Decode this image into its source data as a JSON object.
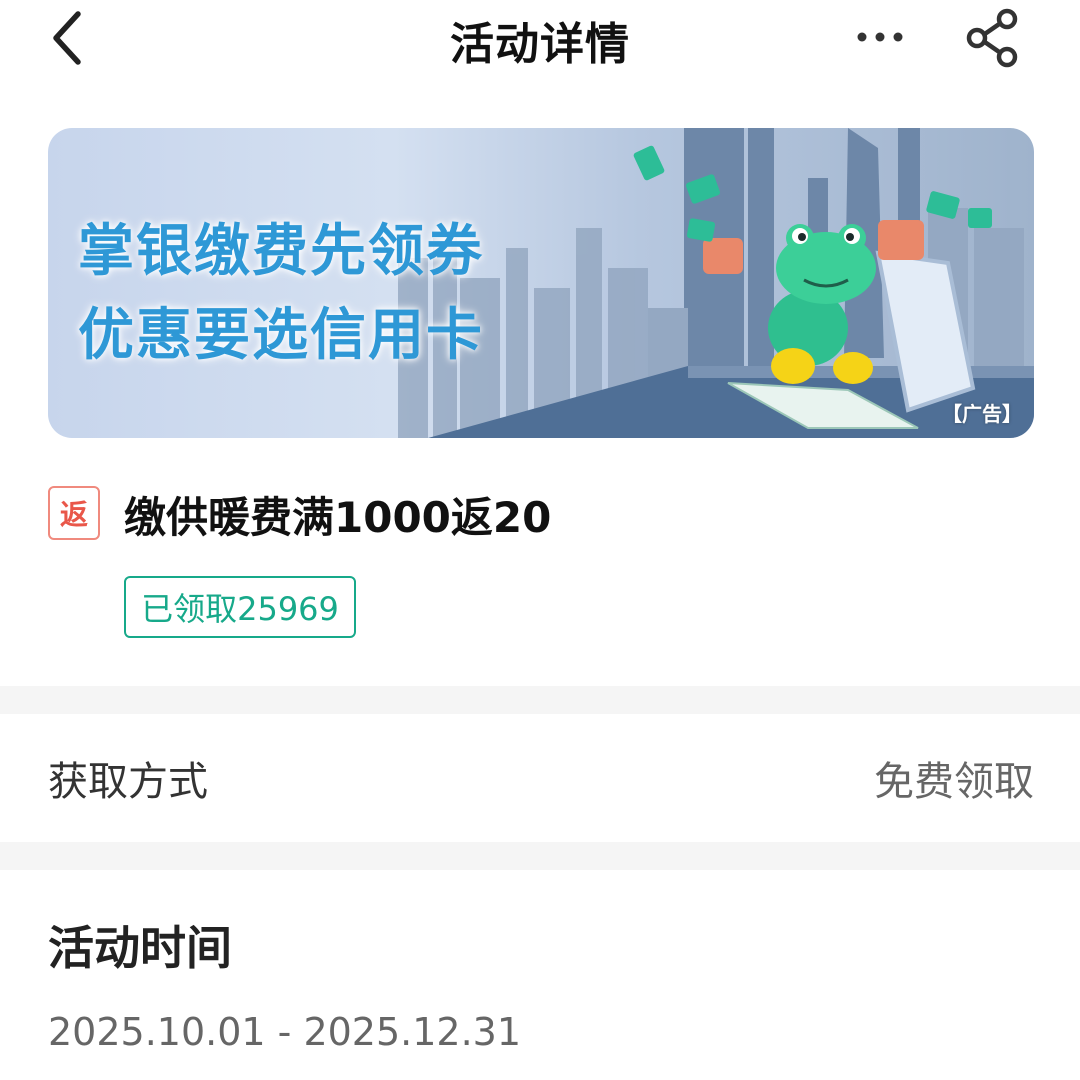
{
  "header": {
    "title": "活动详情",
    "back_icon": "chevron-left-icon",
    "more_icon": "more-dots-icon",
    "share_icon": "share-icon"
  },
  "banner": {
    "line1": "掌银缴费先领券",
    "line2": "优惠要选信用卡",
    "ad_tag": "【广告】",
    "text_color": "#2e98d6"
  },
  "offer": {
    "badge": "返",
    "title": "缴供暖费满1000返20",
    "claimed": "已领取25969",
    "badge_color": "#e9574a",
    "claimed_color": "#17a98a"
  },
  "method": {
    "label": "获取方式",
    "value": "免费领取"
  },
  "time": {
    "title": "活动时间",
    "range": "2025.10.01 - 2025.12.31"
  }
}
